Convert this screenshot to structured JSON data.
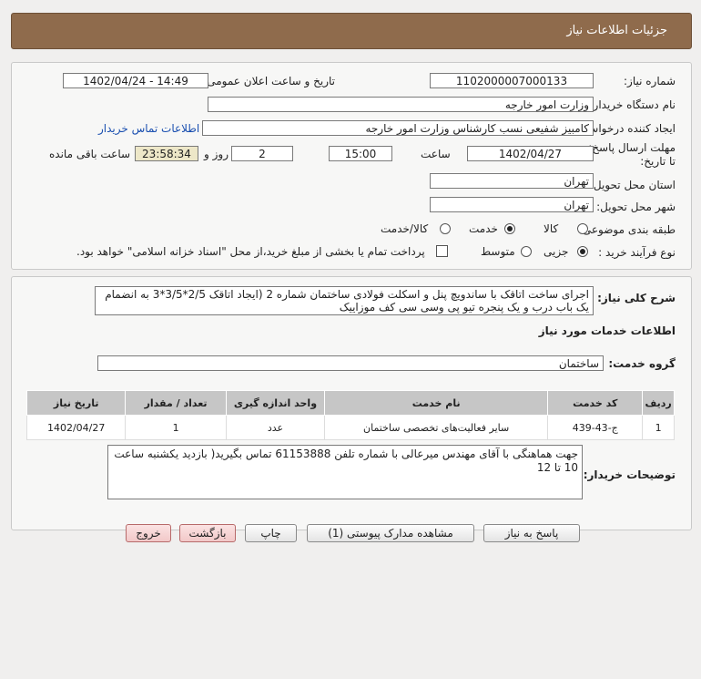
{
  "header": {
    "title": "جزئیات اطلاعات نیاز"
  },
  "form": {
    "need_number_label": "شماره نیاز:",
    "need_number": "1102000007000133",
    "announce_label": "تاریخ و ساعت اعلان عمومی:",
    "announce_value": "1402/04/24 - 14:49",
    "buyer_org_label": "نام دستگاه خریدار:",
    "buyer_org": "وزارت امور خارجه",
    "requester_label": "ایجاد کننده درخواست:",
    "requester": "کامبیز شفیعی نسب کارشناس وزارت امور خارجه",
    "contact_link": "اطلاعات تماس خریدار",
    "deadline_label": "مهلت ارسال پاسخ: تا تاریخ:",
    "deadline_date": "1402/04/27",
    "time_label": "ساعت",
    "deadline_time": "15:00",
    "days_value": "2",
    "days_label": "روز و",
    "remaining_time": "23:58:34",
    "remaining_label": "ساعت باقی مانده",
    "province_label": "استان محل تحویل:",
    "province": "تهران",
    "city_label": "شهر محل تحویل:",
    "city": "تهران",
    "category_label": "طبقه بندی موضوعی:",
    "category_options": [
      "کالا",
      "خدمت",
      "کالا/خدمت"
    ],
    "process_label": "نوع فرآیند خرید :",
    "process_options": [
      "جزیی",
      "متوسط"
    ],
    "payment_note": "پرداخت تمام یا بخشی از مبلغ خرید،از محل \"اسناد خزانه اسلامی\" خواهد بود."
  },
  "description": {
    "label": "شرح کلی نیاز:",
    "text": "اجرای ساخت اتاقک با ساندویچ پنل و اسکلت فولادی ساختمان شماره 2 (ایجاد اتاقک 2/5*3/5*3 به انضمام یک باب درب و یک پنجره تیو پی وسی سی کف موزاییک"
  },
  "services": {
    "section_title": "اطلاعات خدمات مورد نیاز",
    "group_label": "گروه خدمت:",
    "group_value": "ساختمان",
    "columns": [
      "ردیف",
      "کد خدمت",
      "نام خدمت",
      "واحد اندازه گیری",
      "تعداد / مقدار",
      "تاریخ نیاز"
    ],
    "rows": [
      {
        "row": "1",
        "code": "ج-43-439",
        "name": "سایر فعالیت‌های تخصصی ساختمان",
        "unit": "عدد",
        "qty": "1",
        "date": "1402/04/27"
      }
    ]
  },
  "buyer_notes": {
    "label": "توضیحات خریدار:",
    "text": "جهت هماهنگی با آقای مهندس میرعالی با شماره تلفن 61153888 تماس بگیرید( بازدید یکشنبه ساعت 10 تا 12"
  },
  "buttons": {
    "reply": "پاسخ به نیاز",
    "attachments": "مشاهده مدارک پیوستی (1)",
    "print": "چاپ",
    "back": "بازگشت",
    "exit": "خروج"
  },
  "colors": {
    "header": "#8f6b4c",
    "link": "#1a4fb0",
    "remaining_bg": "#ede7c8"
  }
}
